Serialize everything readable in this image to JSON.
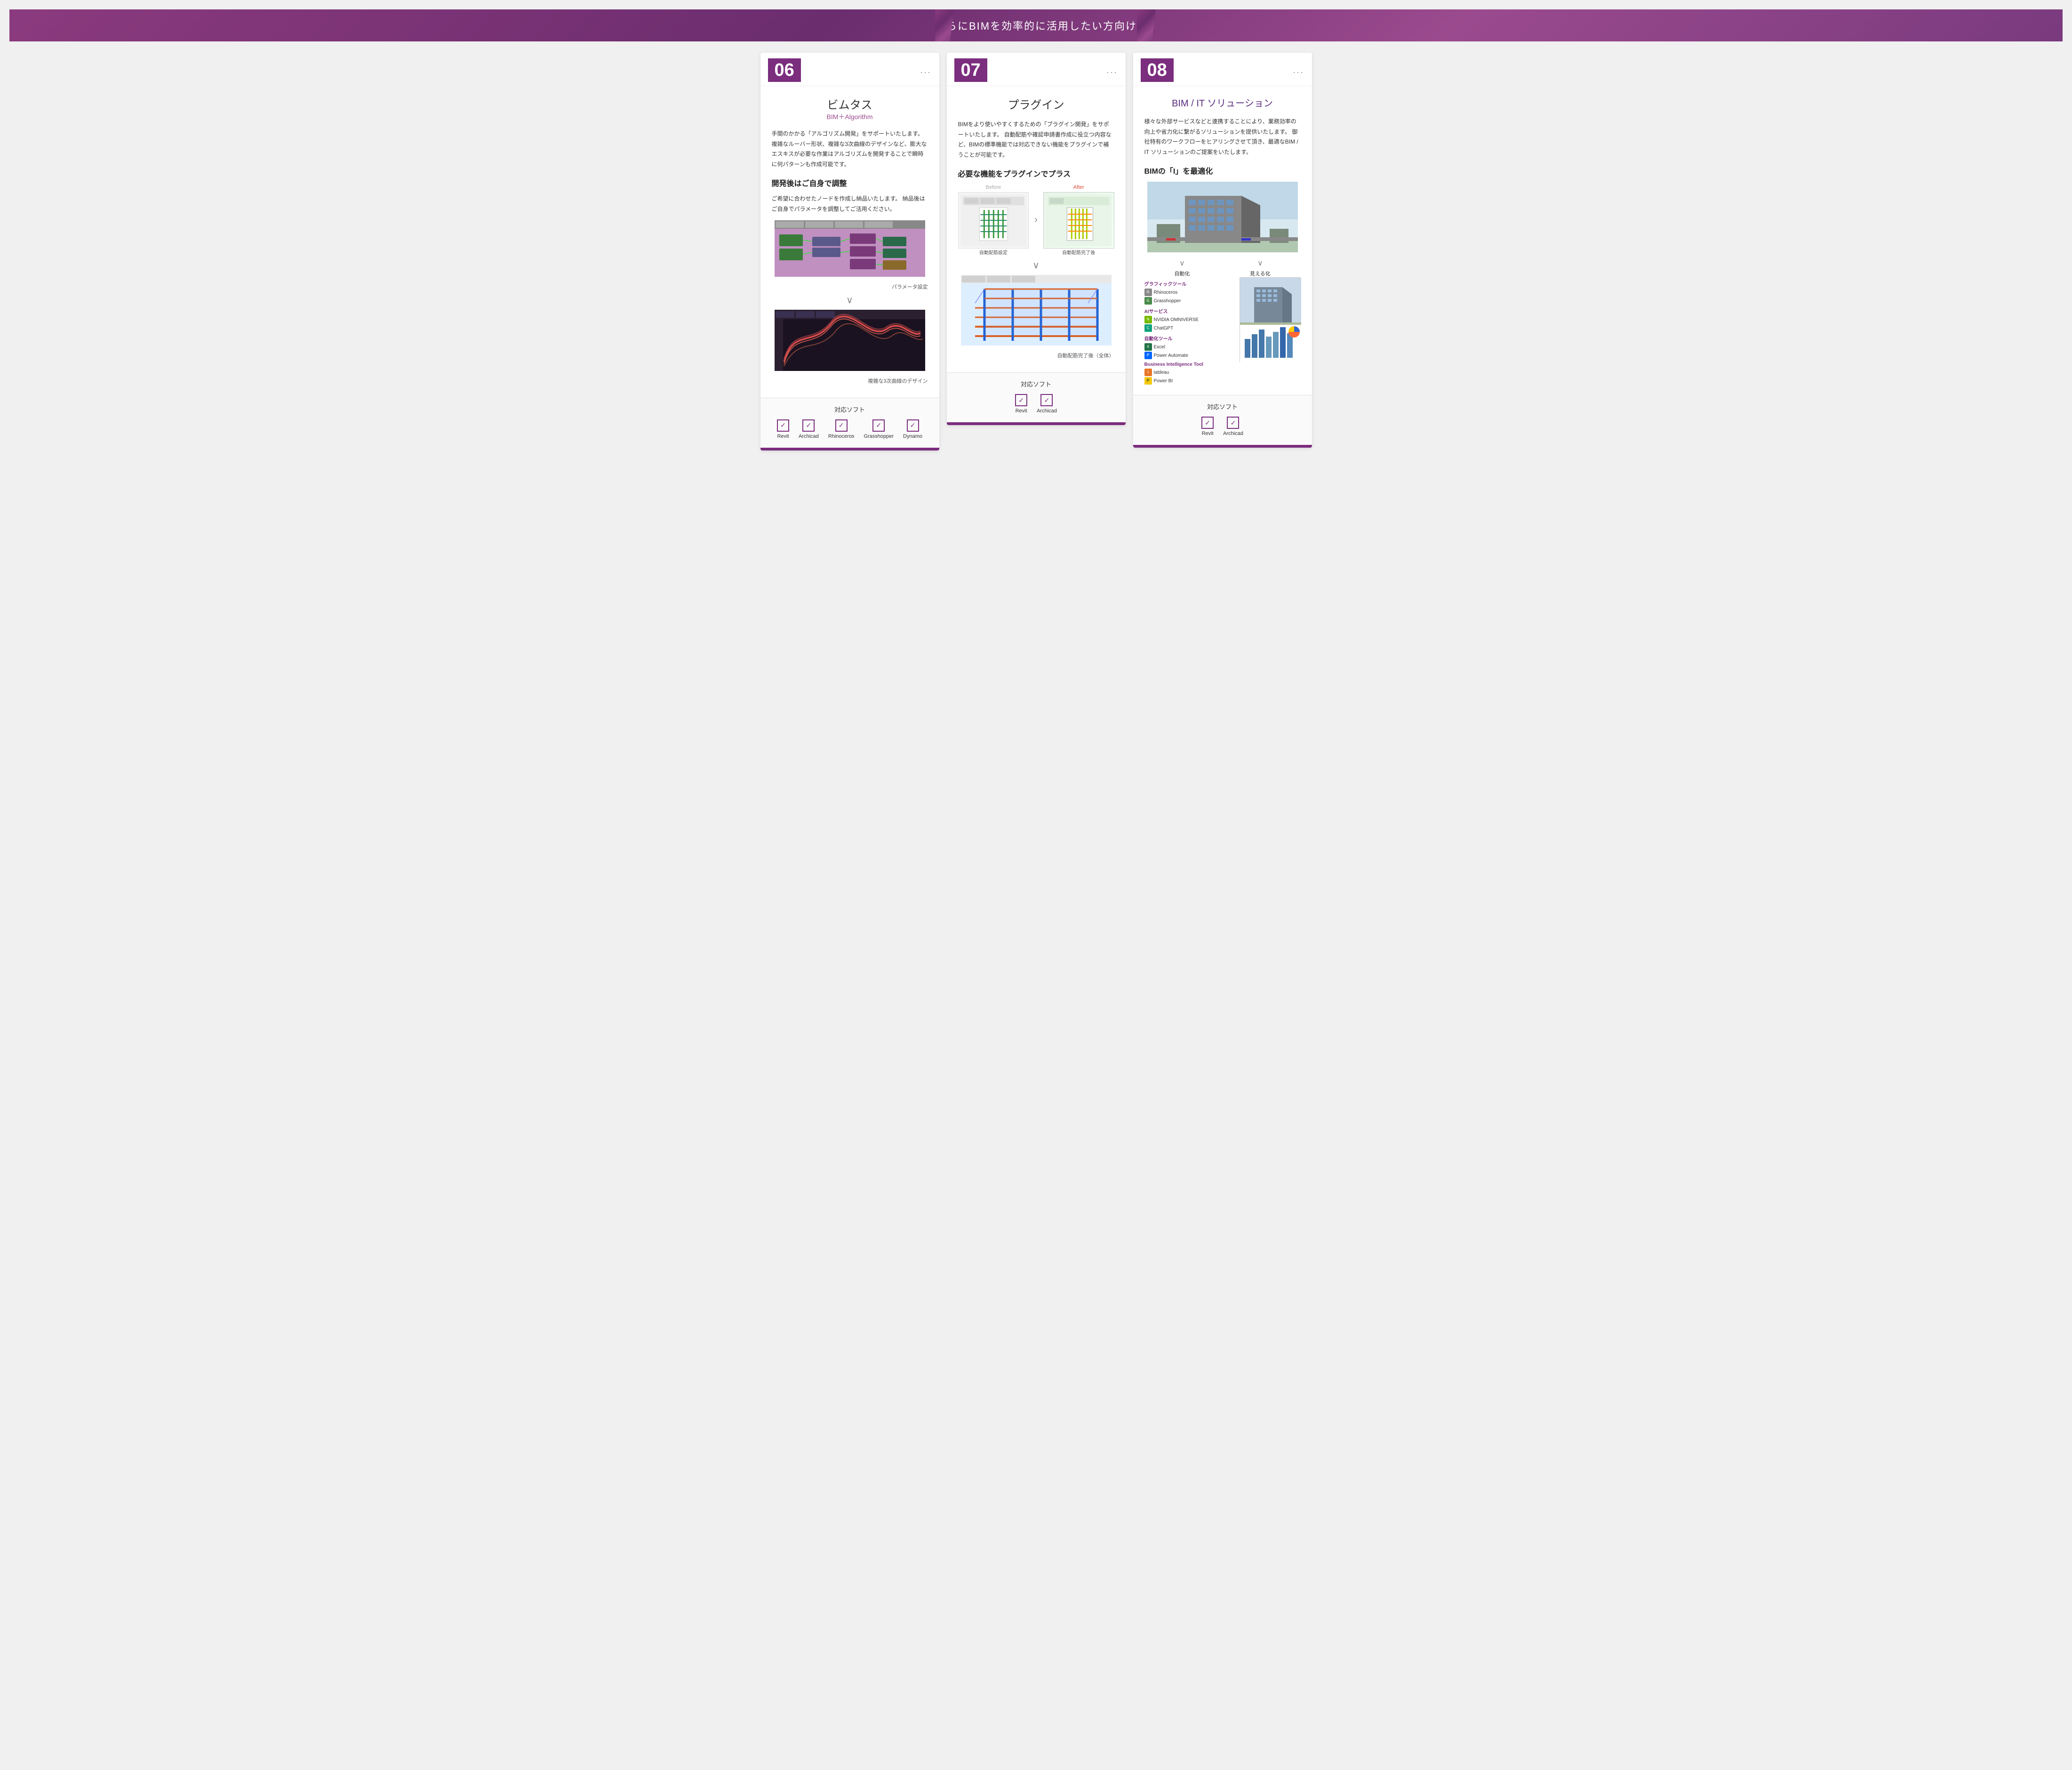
{
  "header": {
    "title": "さらにBIMを効率的に活用したい方向け"
  },
  "cards": [
    {
      "number": "06",
      "dots": "...",
      "title_ja": "ビムタス",
      "title_en": "BIM＋Algorithm",
      "description": "手間のかかる「アルゴリズム開発」をサポートいたします。\n複雑なルーバー形状、複雑な3次曲線のデザインなど、膨大なエスキスが必要な作業はアルゴリズムを開発することで瞬時に何パターンも作成可能です。",
      "section1_title": "開発後はご自身で調整",
      "section1_desc": "ご希望に合わせたノードを作成し納品いたします。\n納品後はご自身でパラメータを調整してご活用ください。",
      "caption1": "パラメータ設定",
      "caption2": "複雑な3次曲線のデザイン",
      "compatible_title": "対応ソフト",
      "software": [
        "Revit",
        "Archicad",
        "Rhinoceros",
        "Grasshopper",
        "Dynamo"
      ]
    },
    {
      "number": "07",
      "dots": "...",
      "title_ja": "プラグイン",
      "title_en": "",
      "description": "BIMをより使いやすくするための「プラグイン開発」をサポートいたします。\n自動配筋や確認申請書作成に役立つ内容など、BIMの標準機能では対応できない機能をプラグインで補うことが可能です。",
      "section1_title": "必要な機能をプラグインでプラス",
      "before_label": "Before",
      "after_label": "After",
      "caption1": "自動配筋設定",
      "caption2": "自動配筋完了後",
      "caption3": "自動配筋完了後（全体）",
      "compatible_title": "対応ソフト",
      "software": [
        "Revit",
        "Archicad"
      ]
    },
    {
      "number": "08",
      "dots": "...",
      "title_ja": "BIM / IT ソリューション",
      "title_en": "",
      "description": "様々な外部サービスなどと連携することにより、業務効率の向上や省力化に繋がるソリューションを提供いたします。\n\n御社特有のワークフローをヒアリングさせて頂き、最適なBIM / IT ソリューションのご提案をいたします。",
      "section1_title": "BIMの「I」を最適化",
      "auto_label1": "自動化",
      "auto_label2": "見える化",
      "tools": {
        "graphic_label": "グラフィックツール",
        "graphic_items": [
          "Rhinoceros",
          "Grasshopper"
        ],
        "ai_label": "AIサービス",
        "ai_items": [
          "NVIDIA OMNIVERSE",
          "ChatGPT"
        ],
        "automation_label": "自動化ツール",
        "automation_items": [
          "Excel",
          "Power Automate"
        ],
        "bi_label": "Business Intelligence Tool",
        "bi_items": [
          "tableau",
          "Power BI"
        ]
      },
      "compatible_title": "対応ソフト",
      "software": [
        "Revit",
        "Archicad"
      ]
    }
  ]
}
